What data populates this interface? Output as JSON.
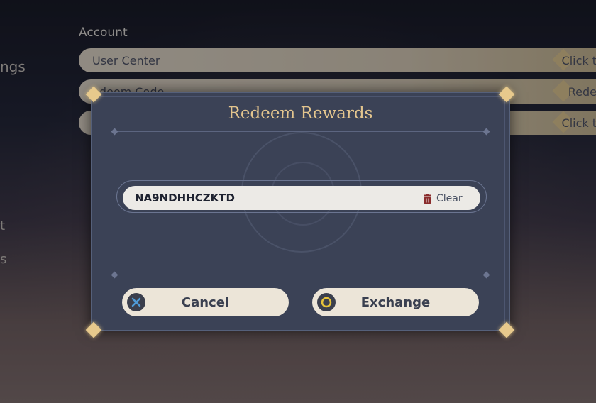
{
  "settings": {
    "section_label": "Account",
    "side_labels": [
      "ngs",
      "t",
      "s"
    ],
    "rows": [
      {
        "left": "User Center",
        "right": "Click t"
      },
      {
        "left": "edeem Code",
        "right": "Rede"
      },
      {
        "left": "",
        "right": "Click t"
      }
    ]
  },
  "dialog": {
    "title": "Redeem Rewards",
    "code_value": "NA9NDHHCZKTD",
    "clear_label": "Clear",
    "cancel_label": "Cancel",
    "exchange_label": "Exchange"
  },
  "icons": {
    "cancel_key": "x-circle-icon",
    "exchange_key": "o-circle-icon",
    "clear": "trash-icon"
  },
  "colors": {
    "title_gold": "#e3c58e",
    "dialog_bg": "#3b4256",
    "button_bg": "#ece5d8",
    "cancel_key_accent": "#4f9bd8",
    "exchange_key_accent": "#e6c23a",
    "trash_red": "#8a2c2c"
  }
}
